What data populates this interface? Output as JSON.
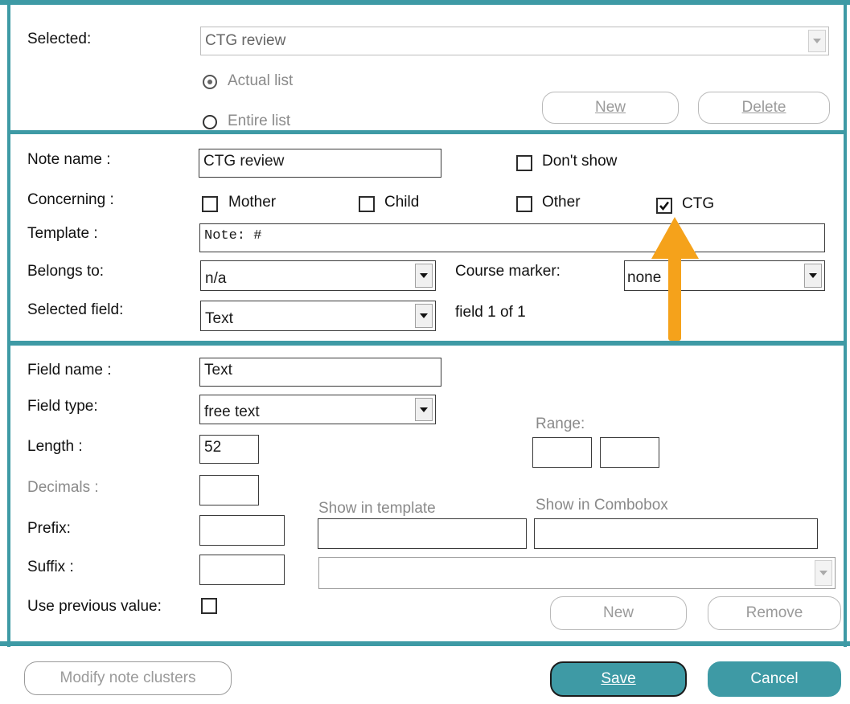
{
  "top": {
    "selected_label": "Selected:",
    "selected_value": "CTG review",
    "radio_actual_label": "Actual list",
    "radio_entire_label": "Entire list",
    "new_button": "New",
    "delete_button": "Delete"
  },
  "note": {
    "note_name_label": "Note name :",
    "note_name_value": "CTG review",
    "dont_show_label": "Don't show",
    "concerning_label": "Concerning :",
    "mother_label": "Mother",
    "child_label": "Child",
    "other_label": "Other",
    "ctg_label": "CTG",
    "template_label": "Template :",
    "template_value": "Note: #",
    "belongs_to_label": "Belongs to:",
    "belongs_to_value": "n/a",
    "course_marker_label": "Course marker:",
    "course_marker_value": "none",
    "selected_field_label": "Selected field:",
    "selected_field_value": "Text",
    "field_count": "field 1 of 1"
  },
  "field": {
    "field_name_label": "Field name :",
    "field_name_value": "Text",
    "field_type_label": "Field type:",
    "field_type_value": "free text",
    "range_label": "Range:",
    "length_label": "Length :",
    "length_value": "52",
    "decimals_label": "Decimals :",
    "show_in_template_label": "Show in template",
    "show_in_combobox_label": "Show in Combobox",
    "prefix_label": "Prefix:",
    "suffix_label": "Suffix :",
    "use_previous_label": "Use previous value:",
    "new_button": "New",
    "remove_button": "Remove"
  },
  "footer": {
    "modify_button": "Modify note clusters",
    "save_button": "Save",
    "cancel_button": "Cancel"
  },
  "colors": {
    "accent": "#3e9aa5",
    "annotation_arrow": "#f5a21b"
  }
}
